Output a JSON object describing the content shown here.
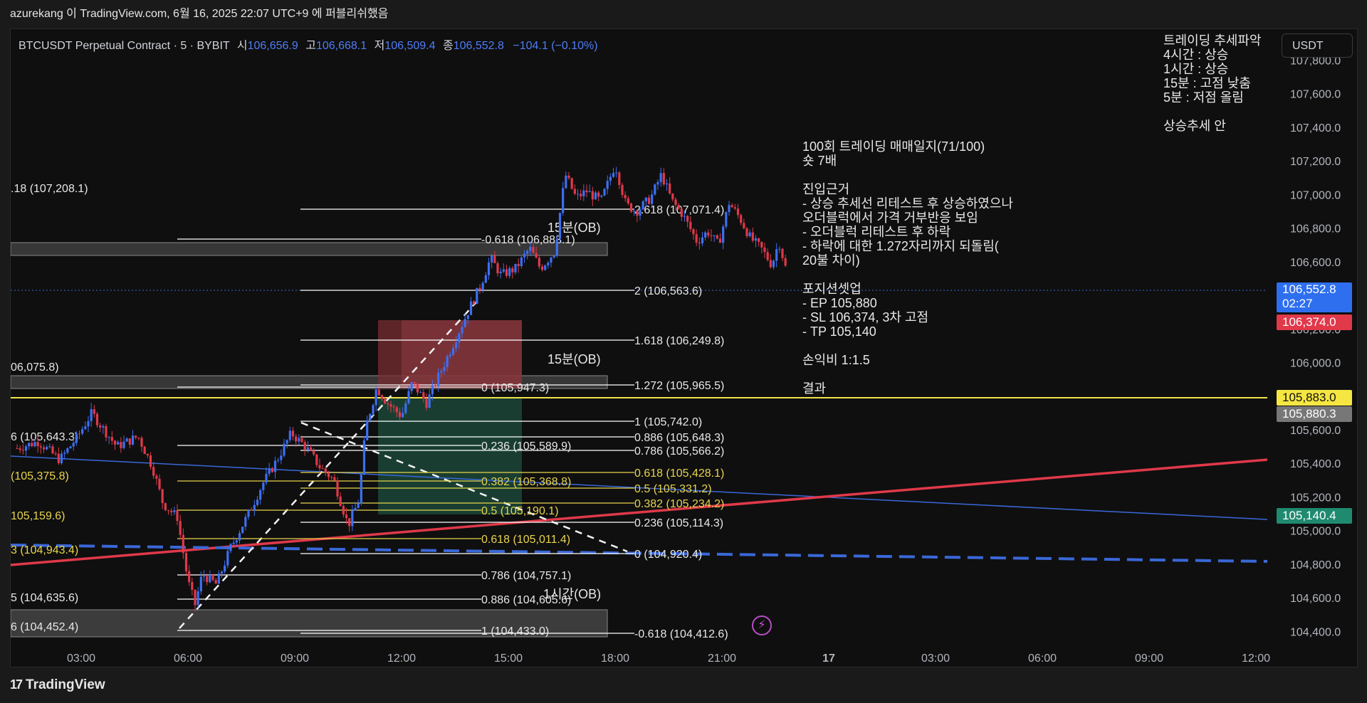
{
  "header": {
    "title": "azurekang 이 TradingView.com, 6월 16, 2025 22:07 UTC+9 에 퍼블리쉬했음"
  },
  "symbol": {
    "name": "BTCUSDT Perpetual Contract · 5 · BYBIT",
    "open_label": "시",
    "open": "106,656.9",
    "high_label": "고",
    "high": "106,668.1",
    "low_label": "저",
    "low": "106,509.4",
    "close_label": "종",
    "close": "106,552.8",
    "change": "−104.1 (−0.10%)"
  },
  "currency_button": "USDT",
  "notes": {
    "trend": "트레이딩 추세파악\n4시간 : 상승\n1시간 : 상승\n15분 : 고점 낮춤\n5분 : 저점 올림\n\n상승추세 안",
    "journal": "100회 트레이딩 매매일지(71/100)\n숏 7배\n\n진입근거\n- 상승 추세선 리테스트 후 상승하였으나\n오더블럭에서 가격 거부반응 보임\n- 오더블럭 리테스트 후 하락\n- 하락에 대한 1.272자리까지 되돌림(\n20불 차이)\n\n포지션셋업\n- EP 105,880\n- SL 106,374, 3차 고점\n- TP 105,140\n\n손익비 1:1.5\n\n결과"
  },
  "price_tags": {
    "current": "106,552.8",
    "countdown": "02:27",
    "sl": "106,374.0",
    "yellow": "105,883.0",
    "entry": "105,880.3",
    "tp": "105,140.4"
  },
  "footer": {
    "brand": "TradingView"
  },
  "chart_data": {
    "type": "candlestick",
    "y_axis": {
      "range": [
        104300,
        107950
      ],
      "ticks": [
        "107,800.0",
        "107,600.0",
        "107,400.0",
        "107,200.0",
        "107,000.0",
        "106,800.0",
        "106,600.0",
        "106,400.0",
        "106,200.0",
        "106,000.0",
        "105,800.0",
        "105,600.0",
        "105,400.0",
        "105,200.0",
        "105,000.0",
        "104,800.0",
        "104,600.0",
        "104,400.0"
      ],
      "tick_values": [
        107800,
        107600,
        107400,
        107200,
        107000,
        106800,
        106600,
        106400,
        106200,
        106000,
        105800,
        105600,
        105400,
        105200,
        105000,
        104800,
        104600,
        104400
      ]
    },
    "x_axis": {
      "ticks": [
        "03:00",
        "06:00",
        "09:00",
        "12:00",
        "15:00",
        "18:00",
        "21:00",
        "17",
        "03:00",
        "06:00",
        "09:00",
        "12:00"
      ],
      "tick_hours": [
        3,
        6,
        9,
        12,
        15,
        18,
        21,
        24,
        27,
        30,
        33,
        36
      ]
    },
    "price_series": [
      [
        1.2,
        105490
      ],
      [
        1.8,
        105530
      ],
      [
        2.4,
        105420
      ],
      [
        2.9,
        105560
      ],
      [
        3.3,
        105700
      ],
      [
        3.5,
        105640
      ],
      [
        4.0,
        105500
      ],
      [
        4.6,
        105560
      ],
      [
        5.0,
        105380
      ],
      [
        5.3,
        105160
      ],
      [
        5.7,
        105080
      ],
      [
        6.0,
        104700
      ],
      [
        6.2,
        104560
      ],
      [
        6.4,
        104740
      ],
      [
        6.8,
        104680
      ],
      [
        7.2,
        104900
      ],
      [
        7.7,
        105100
      ],
      [
        8.1,
        105280
      ],
      [
        8.5,
        105420
      ],
      [
        8.9,
        105580
      ],
      [
        9.3,
        105500
      ],
      [
        9.7,
        105380
      ],
      [
        10.1,
        105300
      ],
      [
        10.5,
        105030
      ],
      [
        10.8,
        105180
      ],
      [
        11.0,
        105620
      ],
      [
        11.3,
        105850
      ],
      [
        11.6,
        105760
      ],
      [
        12.0,
        105680
      ],
      [
        12.3,
        105880
      ],
      [
        12.7,
        105760
      ],
      [
        13.0,
        105900
      ],
      [
        13.3,
        106040
      ],
      [
        13.6,
        106180
      ],
      [
        13.9,
        106320
      ],
      [
        14.2,
        106450
      ],
      [
        14.5,
        106620
      ],
      [
        14.8,
        106520
      ],
      [
        15.2,
        106560
      ],
      [
        15.6,
        106680
      ],
      [
        15.9,
        106560
      ],
      [
        16.3,
        106660
      ],
      [
        16.6,
        107120
      ],
      [
        16.9,
        106980
      ],
      [
        17.2,
        107020
      ],
      [
        17.6,
        106960
      ],
      [
        18.0,
        107180
      ],
      [
        18.3,
        106940
      ],
      [
        18.6,
        106900
      ],
      [
        19.0,
        106980
      ],
      [
        19.3,
        107120
      ],
      [
        19.6,
        106960
      ],
      [
        19.9,
        106880
      ],
      [
        20.3,
        106720
      ],
      [
        20.6,
        106780
      ],
      [
        20.9,
        106700
      ],
      [
        21.2,
        106950
      ],
      [
        21.5,
        106860
      ],
      [
        21.8,
        106740
      ],
      [
        22.1,
        106680
      ],
      [
        22.4,
        106580
      ],
      [
        22.6,
        106720
      ],
      [
        22.8,
        106553
      ]
    ]
  },
  "fib_labels": {
    "a": [
      "2.618 (107,071.4)",
      "2 (106,563.6)",
      "1.618 (106,249.8)",
      "1.272 (105,965.5)",
      "1 (105,742.0)",
      "0.886 (105,648.3)",
      "0.786 (105,566.2)",
      "0.618 (105,428.1)",
      "0.5 (105,331.2)",
      "0.382 (105,234.2)",
      "0.236 (105,114.3)",
      "0 (104,920.4)",
      "-0.618 (104,412.6)"
    ],
    "b": [
      "-0.618 (106,883.1)",
      "0 (105,947.3)",
      "0.236 (105,589.9)",
      "0.382 (105,368.8)",
      "0.5 (105,190.1)",
      "0.618 (105,011.4)",
      "0.786 (104,757.1)",
      "0.886 (104,605.6)",
      "1 (104,433.0)"
    ],
    "c": [
      ".18 (107,208.1)",
      "06,075.8)",
      "6 (105,643.3)",
      "(105,375.8)",
      "105,159.6)",
      "3 (104,943.4)",
      "5 (104,635.6)",
      "6 (104,452.4)"
    ],
    "ob": [
      "15분(OB)",
      "15분(OB)",
      "1시간(OB)"
    ]
  }
}
